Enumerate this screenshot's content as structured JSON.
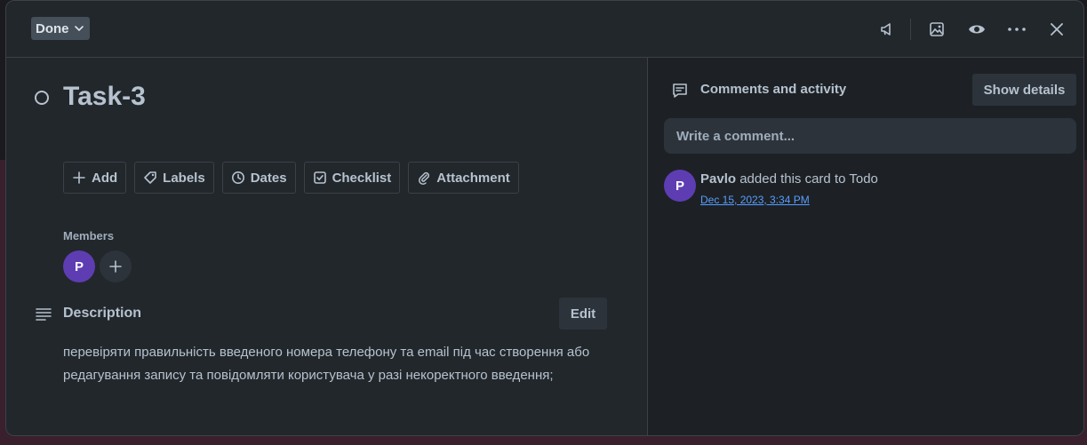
{
  "header": {
    "status_label": "Done",
    "icons": [
      "megaphone-icon",
      "image-icon",
      "eye-icon",
      "more-icon",
      "close-icon"
    ]
  },
  "card": {
    "title": "Task-3"
  },
  "actions": [
    {
      "label": "Add",
      "icon": "plus-icon"
    },
    {
      "label": "Labels",
      "icon": "tag-icon"
    },
    {
      "label": "Dates",
      "icon": "clock-icon"
    },
    {
      "label": "Checklist",
      "icon": "checkbox-icon"
    },
    {
      "label": "Attachment",
      "icon": "paperclip-icon"
    }
  ],
  "members": {
    "label": "Members",
    "avatar_initial": "P"
  },
  "description": {
    "label": "Description",
    "edit_label": "Edit",
    "text_line1": "перевіряти правильність введеного номера телефону та email під час створення або",
    "text_line2": "редагування запису та повідомляти користувача у разі некоректного введення;"
  },
  "activity": {
    "title": "Comments and activity",
    "show_details_label": "Show details",
    "comment_placeholder": "Write a comment...",
    "items": [
      {
        "avatar_initial": "P",
        "user": "Pavlo",
        "action": "added this card to Todo",
        "time": "Dec 15, 2023, 3:34 PM"
      }
    ]
  },
  "colors": {
    "accent_link": "#579dff",
    "avatar_bg": "#5e3db3",
    "modal_bg": "#22272b"
  }
}
